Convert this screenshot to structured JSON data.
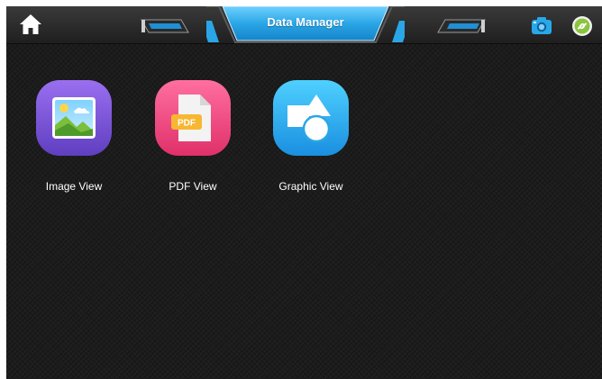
{
  "header": {
    "title": "Data Manager",
    "home_icon": "home-icon",
    "camera_icon": "camera-icon",
    "link_icon": "link-icon"
  },
  "apps": [
    {
      "label": "Image View",
      "icon": "image-view-icon"
    },
    {
      "label": "PDF View",
      "icon": "pdf-view-icon",
      "badge": "PDF"
    },
    {
      "label": "Graphic View",
      "icon": "graphic-view-icon"
    }
  ],
  "colors": {
    "accent": "#29a8e8",
    "background": "#1c1c1c"
  }
}
